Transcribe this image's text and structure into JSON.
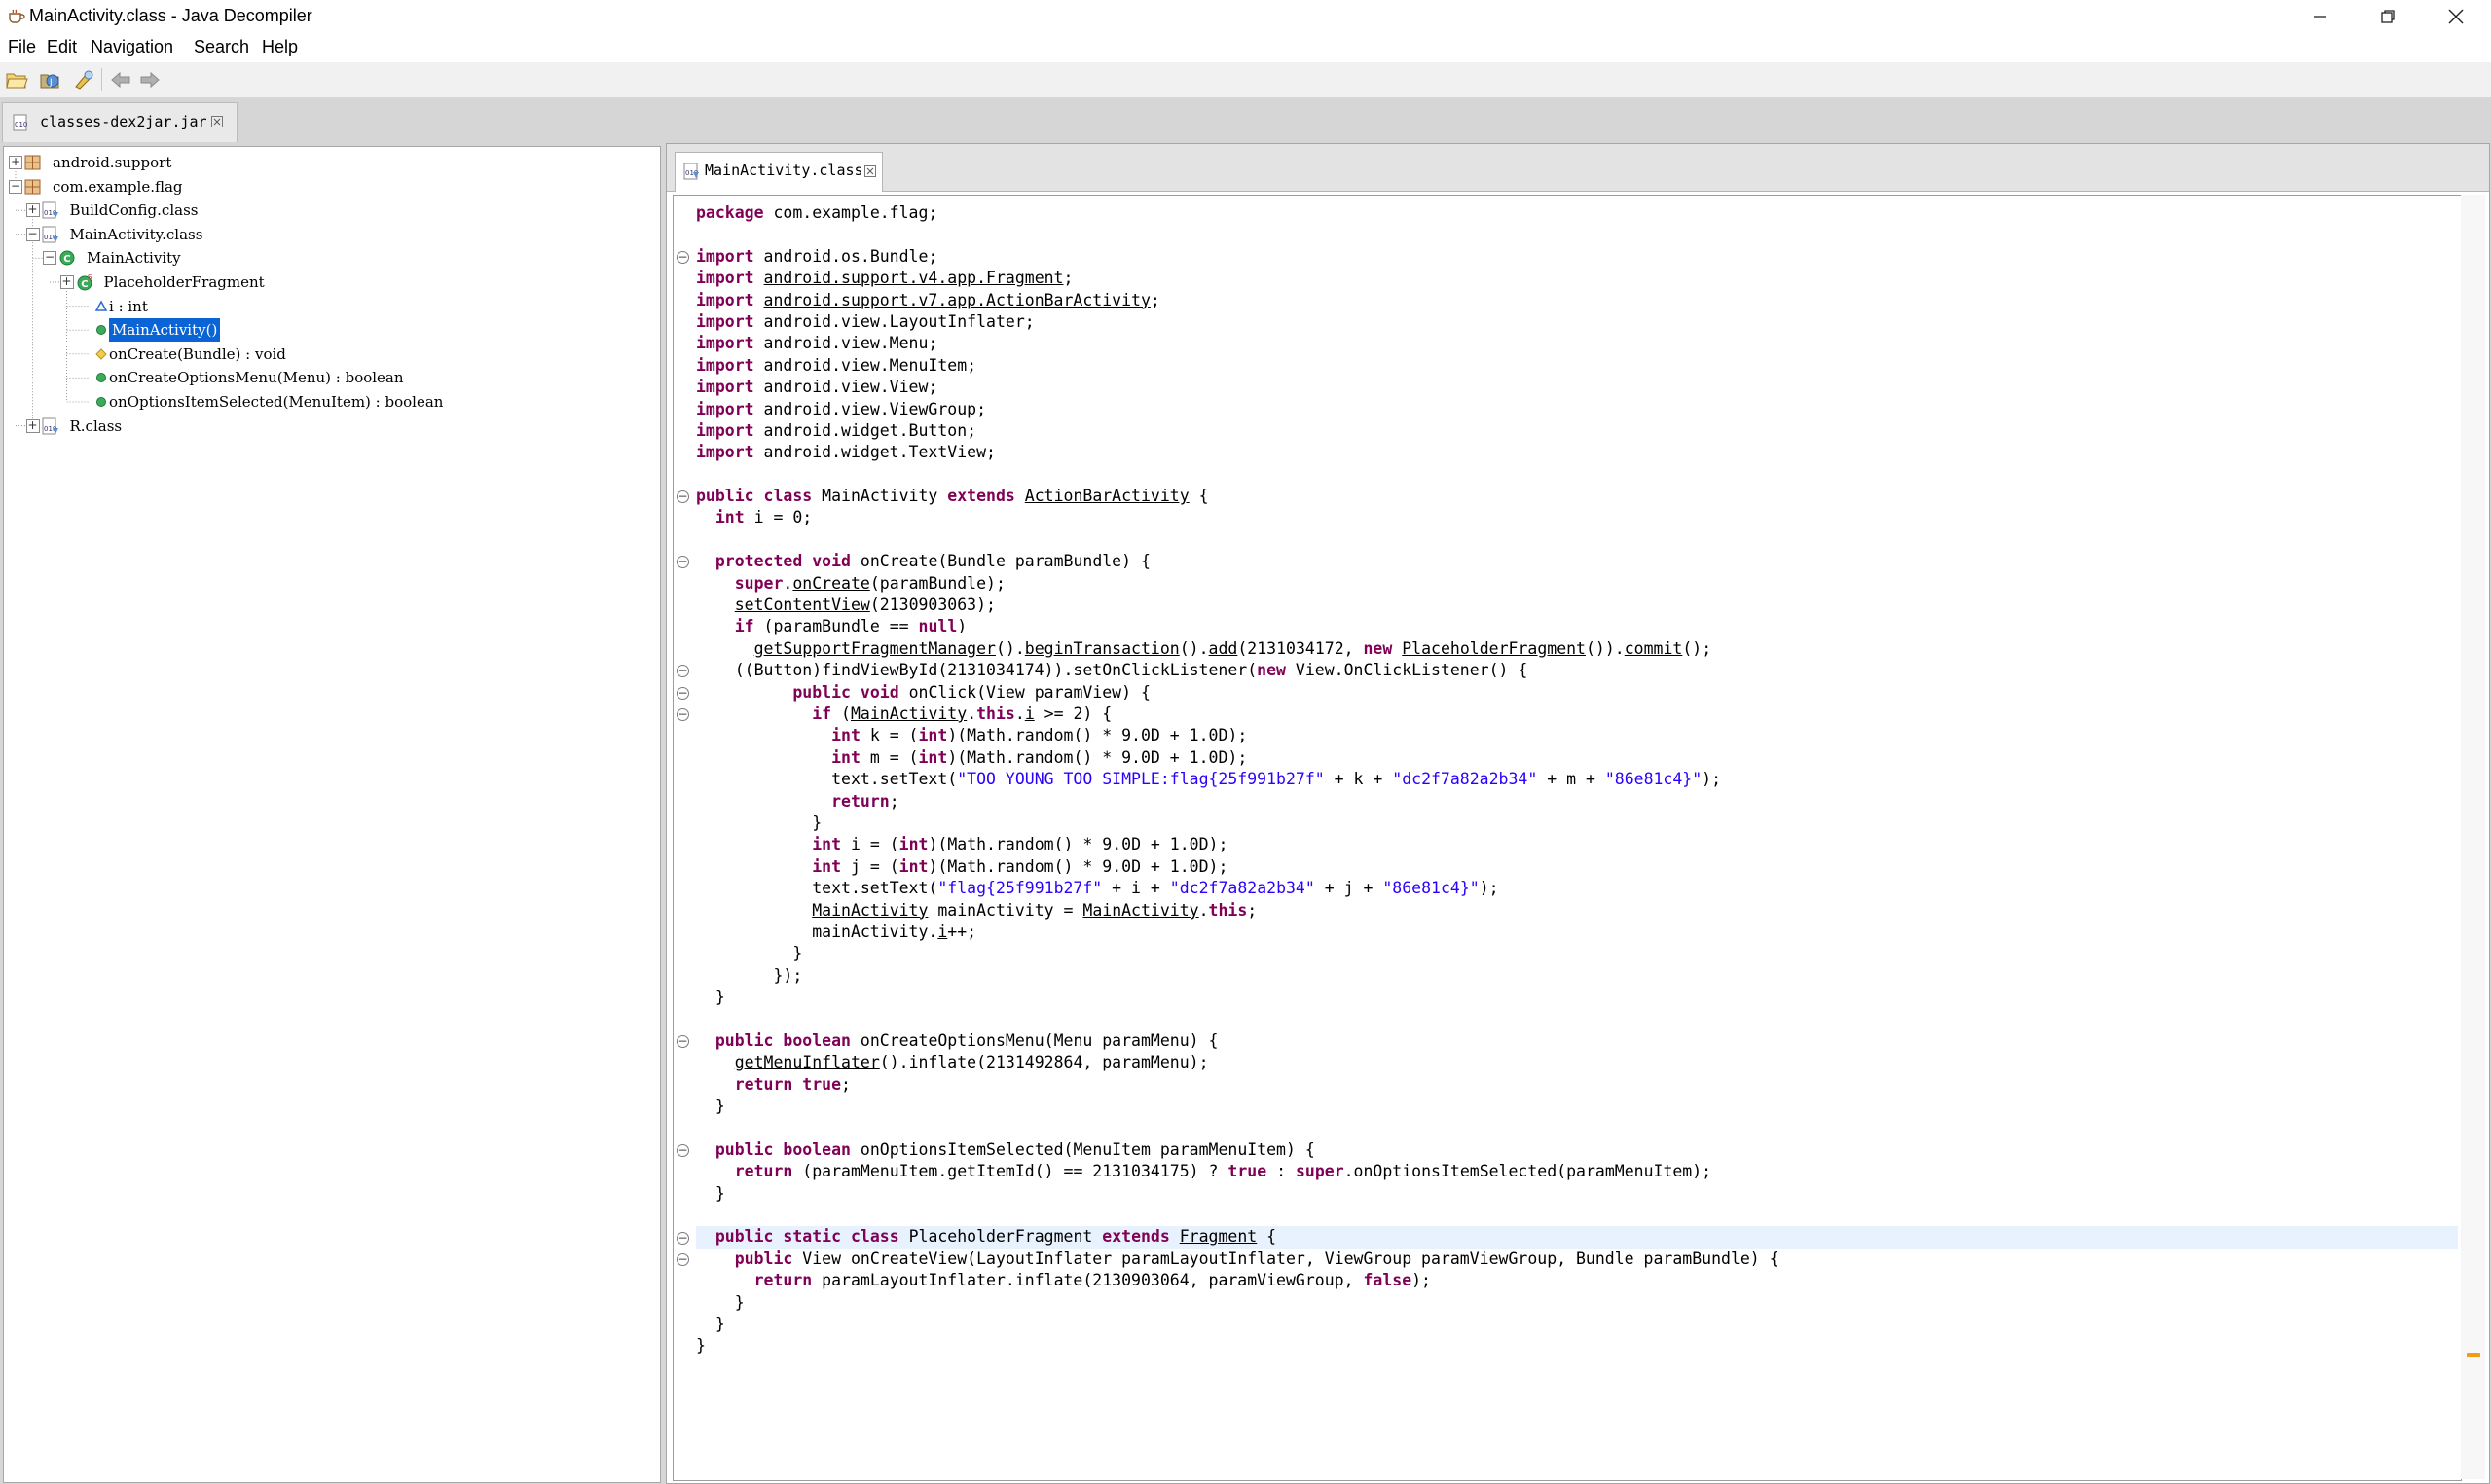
{
  "window": {
    "title": "MainActivity.class - Java Decompiler",
    "controls": [
      "minimize",
      "restore",
      "close"
    ]
  },
  "menu": [
    "File",
    "Edit",
    "Navigation",
    "Search",
    "Help"
  ],
  "toolbar": {
    "icons": [
      "open-file-icon",
      "open-type-icon",
      "search-icon",
      "back-arrow-icon",
      "forward-arrow-icon"
    ]
  },
  "file_tab": {
    "label": "classes-dex2jar.jar"
  },
  "tree": [
    {
      "label": "android.support",
      "kind": "package",
      "expander": "+"
    },
    {
      "label": "com.example.flag",
      "kind": "package",
      "expander": "-"
    },
    {
      "label": "BuildConfig.class",
      "kind": "classfile",
      "expander": "+"
    },
    {
      "label": "MainActivity.class",
      "kind": "classfile",
      "expander": "-"
    },
    {
      "label": "MainActivity",
      "kind": "class",
      "expander": "-"
    },
    {
      "label": "PlaceholderFragment",
      "kind": "inner-class",
      "expander": "+"
    },
    {
      "label": "i : int",
      "kind": "field",
      "expander": ""
    },
    {
      "label": "MainActivity()",
      "kind": "method",
      "expander": "",
      "selected": true
    },
    {
      "label": "onCreate(Bundle) : void",
      "kind": "method-protected",
      "expander": ""
    },
    {
      "label": "onCreateOptionsMenu(Menu) : boolean",
      "kind": "method",
      "expander": ""
    },
    {
      "label": "onOptionsItemSelected(MenuItem) : boolean",
      "kind": "method",
      "expander": ""
    },
    {
      "label": "R.class",
      "kind": "classfile",
      "expander": "+"
    }
  ],
  "editor": {
    "tab_label": "MainActivity.class",
    "code": [
      [
        [
          "kw",
          "package"
        ],
        [
          "t",
          " com.example.flag;"
        ]
      ],
      [],
      [
        [
          "kw",
          "import"
        ],
        [
          "t",
          " android.os.Bundle;"
        ]
      ],
      [
        [
          "kw",
          "import"
        ],
        [
          "t",
          " "
        ],
        [
          "ln",
          "android.support.v4.app.Fragment"
        ],
        [
          "t",
          ";"
        ]
      ],
      [
        [
          "kw",
          "import"
        ],
        [
          "t",
          " "
        ],
        [
          "ln",
          "android.support.v7.app.ActionBarActivity"
        ],
        [
          "t",
          ";"
        ]
      ],
      [
        [
          "kw",
          "import"
        ],
        [
          "t",
          " android.view.LayoutInflater;"
        ]
      ],
      [
        [
          "kw",
          "import"
        ],
        [
          "t",
          " android.view.Menu;"
        ]
      ],
      [
        [
          "kw",
          "import"
        ],
        [
          "t",
          " android.view.MenuItem;"
        ]
      ],
      [
        [
          "kw",
          "import"
        ],
        [
          "t",
          " android.view.View;"
        ]
      ],
      [
        [
          "kw",
          "import"
        ],
        [
          "t",
          " android.view.ViewGroup;"
        ]
      ],
      [
        [
          "kw",
          "import"
        ],
        [
          "t",
          " android.widget.Button;"
        ]
      ],
      [
        [
          "kw",
          "import"
        ],
        [
          "t",
          " android.widget.TextView;"
        ]
      ],
      [],
      [
        [
          "kw",
          "public"
        ],
        [
          "t",
          " "
        ],
        [
          "kw",
          "class"
        ],
        [
          "t",
          " MainActivity "
        ],
        [
          "kw",
          "extends"
        ],
        [
          "t",
          " "
        ],
        [
          "ln",
          "ActionBarActivity"
        ],
        [
          "t",
          " {"
        ]
      ],
      [
        [
          "t",
          "  "
        ],
        [
          "kw",
          "int"
        ],
        [
          "t",
          " i = 0;"
        ]
      ],
      [],
      [
        [
          "t",
          "  "
        ],
        [
          "kw",
          "protected"
        ],
        [
          "t",
          " "
        ],
        [
          "kw",
          "void"
        ],
        [
          "t",
          " onCreate(Bundle paramBundle) {"
        ]
      ],
      [
        [
          "t",
          "    "
        ],
        [
          "kw",
          "super"
        ],
        [
          "t",
          "."
        ],
        [
          "ln",
          "onCreate"
        ],
        [
          "t",
          "(paramBundle);"
        ]
      ],
      [
        [
          "t",
          "    "
        ],
        [
          "ln",
          "setContentView"
        ],
        [
          "t",
          "(2130903063);"
        ]
      ],
      [
        [
          "t",
          "    "
        ],
        [
          "kw",
          "if"
        ],
        [
          "t",
          " (paramBundle == "
        ],
        [
          "kw",
          "null"
        ],
        [
          "t",
          ")"
        ]
      ],
      [
        [
          "t",
          "      "
        ],
        [
          "ln",
          "getSupportFragmentManager"
        ],
        [
          "t",
          "()."
        ],
        [
          "ln",
          "beginTransaction"
        ],
        [
          "t",
          "()."
        ],
        [
          "ln",
          "add"
        ],
        [
          "t",
          "(2131034172, "
        ],
        [
          "kw",
          "new"
        ],
        [
          "t",
          " "
        ],
        [
          "ln",
          "PlaceholderFragment"
        ],
        [
          "t",
          "())."
        ],
        [
          "ln",
          "commit"
        ],
        [
          "t",
          "();"
        ]
      ],
      [
        [
          "t",
          "    ((Button)findViewById(2131034174)).setOnClickListener("
        ],
        [
          "kw",
          "new"
        ],
        [
          "t",
          " View.OnClickListener() {"
        ]
      ],
      [
        [
          "t",
          "          "
        ],
        [
          "kw",
          "public"
        ],
        [
          "t",
          " "
        ],
        [
          "kw",
          "void"
        ],
        [
          "t",
          " onClick(View paramView) {"
        ]
      ],
      [
        [
          "t",
          "            "
        ],
        [
          "kw",
          "if"
        ],
        [
          "t",
          " ("
        ],
        [
          "ln",
          "MainActivity"
        ],
        [
          "t",
          "."
        ],
        [
          "kw",
          "this"
        ],
        [
          "t",
          "."
        ],
        [
          "ln",
          "i"
        ],
        [
          "t",
          " >= 2) {"
        ]
      ],
      [
        [
          "t",
          "              "
        ],
        [
          "kw",
          "int"
        ],
        [
          "t",
          " k = ("
        ],
        [
          "kw",
          "int"
        ],
        [
          "t",
          ")(Math.random() * 9.0D + 1.0D);"
        ]
      ],
      [
        [
          "t",
          "              "
        ],
        [
          "kw",
          "int"
        ],
        [
          "t",
          " m = ("
        ],
        [
          "kw",
          "int"
        ],
        [
          "t",
          ")(Math.random() * 9.0D + 1.0D);"
        ]
      ],
      [
        [
          "t",
          "              text.setText("
        ],
        [
          "str",
          "\"TOO YOUNG TOO SIMPLE:flag{25f991b27f\""
        ],
        [
          "t",
          " + k + "
        ],
        [
          "str",
          "\"dc2f7a82a2b34\""
        ],
        [
          "t",
          " + m + "
        ],
        [
          "str",
          "\"86e81c4}\""
        ],
        [
          "t",
          ");"
        ]
      ],
      [
        [
          "t",
          "              "
        ],
        [
          "kw",
          "return"
        ],
        [
          "t",
          ";"
        ]
      ],
      [
        [
          "t",
          "            }"
        ]
      ],
      [
        [
          "t",
          "            "
        ],
        [
          "kw",
          "int"
        ],
        [
          "t",
          " i = ("
        ],
        [
          "kw",
          "int"
        ],
        [
          "t",
          ")(Math.random() * 9.0D + 1.0D);"
        ]
      ],
      [
        [
          "t",
          "            "
        ],
        [
          "kw",
          "int"
        ],
        [
          "t",
          " j = ("
        ],
        [
          "kw",
          "int"
        ],
        [
          "t",
          ")(Math.random() * 9.0D + 1.0D);"
        ]
      ],
      [
        [
          "t",
          "            text.setText("
        ],
        [
          "str",
          "\"flag{25f991b27f\""
        ],
        [
          "t",
          " + i + "
        ],
        [
          "str",
          "\"dc2f7a82a2b34\""
        ],
        [
          "t",
          " + j + "
        ],
        [
          "str",
          "\"86e81c4}\""
        ],
        [
          "t",
          ");"
        ]
      ],
      [
        [
          "t",
          "            "
        ],
        [
          "ln",
          "MainActivity"
        ],
        [
          "t",
          " mainActivity = "
        ],
        [
          "ln",
          "MainActivity"
        ],
        [
          "t",
          "."
        ],
        [
          "kw",
          "this"
        ],
        [
          "t",
          ";"
        ]
      ],
      [
        [
          "t",
          "            mainActivity."
        ],
        [
          "ln",
          "i"
        ],
        [
          "t",
          "++;"
        ]
      ],
      [
        [
          "t",
          "          }"
        ]
      ],
      [
        [
          "t",
          "        });"
        ]
      ],
      [
        [
          "t",
          "  }"
        ]
      ],
      [],
      [
        [
          "t",
          "  "
        ],
        [
          "kw",
          "public"
        ],
        [
          "t",
          " "
        ],
        [
          "kw",
          "boolean"
        ],
        [
          "t",
          " onCreateOptionsMenu(Menu paramMenu) {"
        ]
      ],
      [
        [
          "t",
          "    "
        ],
        [
          "ln",
          "getMenuInflater"
        ],
        [
          "t",
          "().inflate(2131492864, paramMenu);"
        ]
      ],
      [
        [
          "t",
          "    "
        ],
        [
          "kw",
          "return"
        ],
        [
          "t",
          " "
        ],
        [
          "kw",
          "true"
        ],
        [
          "t",
          ";"
        ]
      ],
      [
        [
          "t",
          "  }"
        ]
      ],
      [],
      [
        [
          "t",
          "  "
        ],
        [
          "kw",
          "public"
        ],
        [
          "t",
          " "
        ],
        [
          "kw",
          "boolean"
        ],
        [
          "t",
          " onOptionsItemSelected(MenuItem paramMenuItem) {"
        ]
      ],
      [
        [
          "t",
          "    "
        ],
        [
          "kw",
          "return"
        ],
        [
          "t",
          " (paramMenuItem.getItemId() == 2131034175) ? "
        ],
        [
          "kw",
          "true"
        ],
        [
          "t",
          " : "
        ],
        [
          "kw",
          "super"
        ],
        [
          "t",
          ".onOptionsItemSelected(paramMenuItem);"
        ]
      ],
      [
        [
          "t",
          "  }"
        ]
      ],
      [],
      [
        [
          "t",
          "  "
        ],
        [
          "kw",
          "public"
        ],
        [
          "t",
          " "
        ],
        [
          "kw",
          "static"
        ],
        [
          "t",
          " "
        ],
        [
          "kw",
          "class"
        ],
        [
          "t",
          " PlaceholderFragment "
        ],
        [
          "kw",
          "extends"
        ],
        [
          "t",
          " "
        ],
        [
          "ln",
          "Fragment"
        ],
        [
          "t",
          " {"
        ]
      ],
      [
        [
          "t",
          "    "
        ],
        [
          "kw",
          "public"
        ],
        [
          "t",
          " View onCreateView(LayoutInflater paramLayoutInflater, ViewGroup paramViewGroup, Bundle paramBundle) {"
        ]
      ],
      [
        [
          "t",
          "      "
        ],
        [
          "kw",
          "return"
        ],
        [
          "t",
          " paramLayoutInflater.inflate(2130903064, paramViewGroup, "
        ],
        [
          "kw",
          "false"
        ],
        [
          "t",
          ");"
        ]
      ],
      [
        [
          "t",
          "    }"
        ]
      ],
      [
        [
          "t",
          "  }"
        ]
      ],
      [
        [
          "t",
          "}"
        ]
      ]
    ],
    "fold_lines": [
      2,
      13,
      16,
      21,
      22,
      23,
      38,
      43,
      47,
      48
    ],
    "highlight_line": 47
  },
  "colors": {
    "keyword": "#7f0055",
    "string": "#2a00ff",
    "selection": "#0a64d6",
    "current_line": "#e8f2fe",
    "overview_marker": "#f39c12"
  }
}
